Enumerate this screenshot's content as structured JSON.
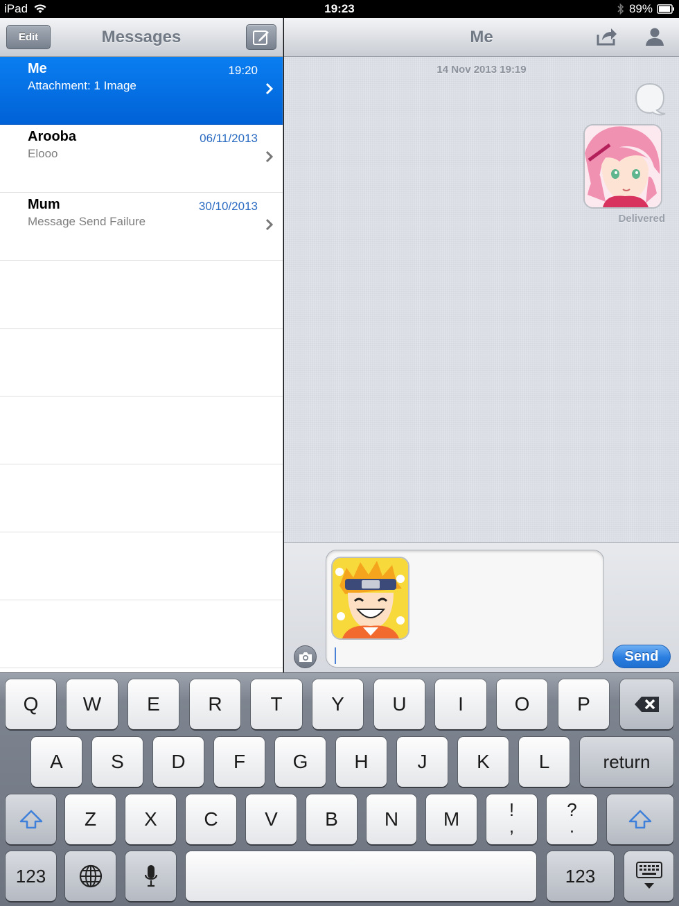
{
  "status_bar": {
    "device": "iPad",
    "time": "19:23",
    "battery": "89%"
  },
  "left_pane": {
    "edit_label": "Edit",
    "title": "Messages",
    "conversations": [
      {
        "name": "Me",
        "preview": "Attachment: 1 Image",
        "date": "19:20",
        "selected": true
      },
      {
        "name": "Arooba",
        "preview": "Elooo",
        "date": "06/11/2013",
        "selected": false
      },
      {
        "name": "Mum",
        "preview": "Message Send Failure",
        "date": "30/10/2013",
        "selected": false
      }
    ]
  },
  "right_pane": {
    "title": "Me",
    "timestamp": "14 Nov 2013 19:19",
    "status": "Delivered"
  },
  "composer": {
    "send_label": "Send"
  },
  "keyboard": {
    "row1": [
      "Q",
      "W",
      "E",
      "R",
      "T",
      "Y",
      "U",
      "I",
      "O",
      "P"
    ],
    "row2": [
      "A",
      "S",
      "D",
      "F",
      "G",
      "H",
      "J",
      "K",
      "L"
    ],
    "return_label": "return",
    "row3": [
      "Z",
      "X",
      "C",
      "V",
      "B",
      "N",
      "M"
    ],
    "punct1_top": "!",
    "punct1_bottom": ",",
    "punct2_top": "?",
    "punct2_bottom": ".",
    "numbers_label": "123"
  },
  "colors": {
    "accent": "#0a7ef1",
    "send_button": "#2a7ee0",
    "date_text": "#2a6bc2"
  },
  "icons": [
    "wifi-icon",
    "bluetooth-icon",
    "battery-icon",
    "compose-icon",
    "chevron-right-icon",
    "share-icon",
    "contact-icon",
    "camera-icon",
    "backspace-icon",
    "shift-icon",
    "globe-icon",
    "microphone-icon",
    "keyboard-dismiss-icon"
  ]
}
